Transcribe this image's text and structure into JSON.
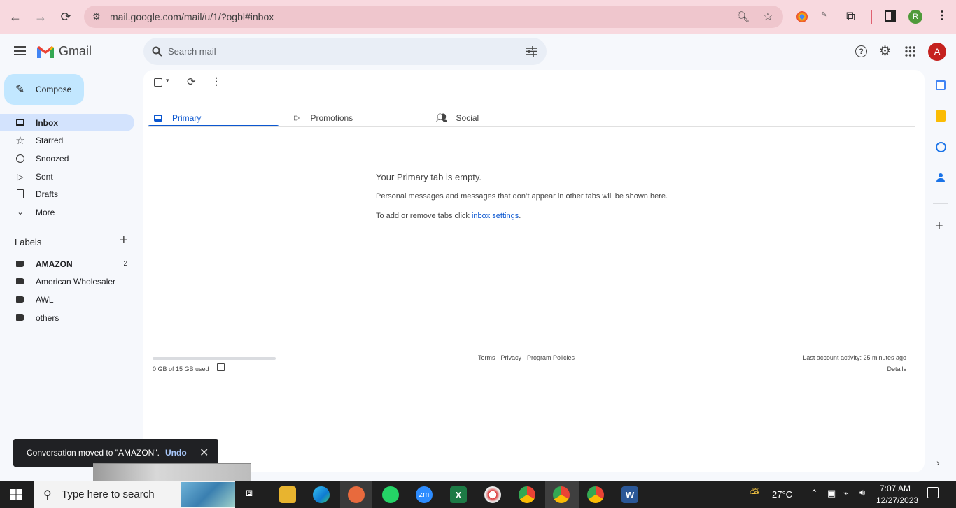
{
  "browser": {
    "url": "mail.google.com/mail/u/1/?ogbl#inbox",
    "profile_initial": "R"
  },
  "gmail": {
    "logo_text": "Gmail",
    "search_placeholder": "Search mail",
    "account_initial": "A",
    "compose_label": "Compose",
    "nav": [
      {
        "label": "Inbox",
        "icon": "inbox-icon",
        "active": true
      },
      {
        "label": "Starred",
        "icon": "star-icon"
      },
      {
        "label": "Snoozed",
        "icon": "clock-icon"
      },
      {
        "label": "Sent",
        "icon": "send-icon"
      },
      {
        "label": "Drafts",
        "icon": "draft-icon"
      },
      {
        "label": "More",
        "icon": "chevron-down-icon"
      }
    ],
    "labels_title": "Labels",
    "labels": [
      {
        "label": "AMAZON",
        "count": "2",
        "bold": true
      },
      {
        "label": "American Wholesaler"
      },
      {
        "label": "AWL"
      },
      {
        "label": "others"
      }
    ],
    "tabs": [
      {
        "label": "Primary",
        "icon": "inbox-icon",
        "active": true
      },
      {
        "label": "Promotions",
        "icon": "tag-icon"
      },
      {
        "label": "Social",
        "icon": "people-icon"
      }
    ],
    "empty": {
      "title": "Your Primary tab is empty.",
      "line1": "Personal messages and messages that don’t appear in other tabs will be shown here.",
      "line2_prefix": "To add or remove tabs click ",
      "line2_link": "inbox settings",
      "line2_suffix": "."
    },
    "footer": {
      "storage": "0 GB of 15 GB used",
      "storage_fraction": 0.0,
      "links": "Terms · Privacy · Program Policies",
      "activity": "Last account activity: 25 minutes ago",
      "details": "Details"
    },
    "toast": {
      "text": "Conversation moved to \"AMAZON\".",
      "undo": "Undo"
    },
    "accent_color": "#0b57d0"
  },
  "taskbar": {
    "search_placeholder": "Type here to search",
    "weather": "27°C",
    "time": "7:07 AM",
    "date": "12/27/2023"
  }
}
